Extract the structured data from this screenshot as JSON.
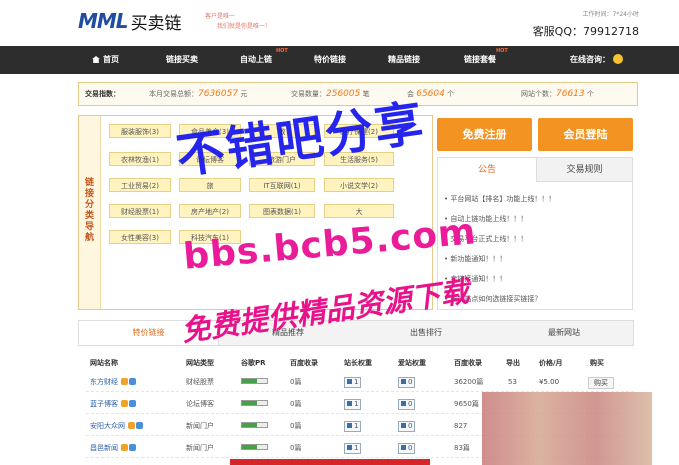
{
  "header": {
    "logo_mark": "MML",
    "logo_cn": "买卖链",
    "slogan_line1": "客户是唯一",
    "slogan_line2": "我们就是你是唯一!",
    "work_time": "工作时间：7*24小时",
    "qq": "客服QQ：79912718"
  },
  "nav": {
    "items": [
      "首页",
      "链接买卖",
      "自动上链",
      "特价链接",
      "精品链接",
      "链接套餐"
    ],
    "hot_tag": "HOT",
    "consult": "在线咨询："
  },
  "stats": {
    "title": "交易指数：",
    "month_label": "本月交易总额：",
    "month_value": "7636057",
    "month_unit": "元",
    "count_label": "交易数量：",
    "count_value": "256005",
    "count_unit": "笔",
    "member_label": "会",
    "member_value": "65604",
    "member_unit": "个",
    "site_label": "网站个数：",
    "site_value": "76613",
    "site_unit": "个"
  },
  "categories": {
    "side_label": "链接分类导航",
    "items": [
      "服装服饰(3)",
      "食品美食(3)",
      "教",
      "医疗保健(2)",
      "农林牧渔(1)",
      "论坛博客",
      "旅游门户",
      "生活服务(5)",
      "工业贸易(2)",
      "旅",
      "IT互联网(1)",
      "小说文学(2)",
      "财经股票(1)",
      "房产地产(2)",
      "图表数据(1)",
      "大",
      "女性美容(3)",
      "科技汽车(1)"
    ]
  },
  "actions": {
    "register": "免费注册",
    "login": "会员登陆"
  },
  "notices": {
    "tab_notice": "公告",
    "tab_rules": "交易规则",
    "items": [
      "平台网站【排名】功能上线！！！",
      "自动上链功能上线！！！",
      "交易平台正式上线！！！",
      "新功能通知！！！",
      "卖链接通知！！！",
      "正规站点如何选链接买链接？"
    ]
  },
  "table": {
    "tabs": [
      "特价链接",
      "精品推荐",
      "出售排行",
      "最新网站"
    ],
    "headers": [
      "网站名称",
      "网站类型",
      "谷歌PR",
      "百度收录",
      "站长权重",
      "爱站权重",
      "百度收录",
      "导出",
      "价格/月",
      "购买"
    ],
    "rows": [
      {
        "name": "东方财经",
        "type": "财经股票",
        "pr": 0.6,
        "index": "0篇",
        "w1": "1",
        "w2": "0",
        "baidu": "36200篇",
        "out": "53",
        "price": "¥5.00",
        "buy": "购买"
      },
      {
        "name": "蓝子博客",
        "type": "论坛博客",
        "pr": 0.6,
        "index": "0篇",
        "w1": "1",
        "w2": "0",
        "baidu": "9650篇",
        "out": "",
        "price": "",
        "buy": ""
      },
      {
        "name": "安阳大众网",
        "type": "新闻门户",
        "pr": 0.6,
        "index": "0篇",
        "w1": "1",
        "w2": "0",
        "baidu": "827",
        "out": "",
        "price": "",
        "buy": ""
      },
      {
        "name": "昌邑新闻",
        "type": "新闻门户",
        "pr": 0.6,
        "index": "0篇",
        "w1": "1",
        "w2": "0",
        "baidu": "83篇",
        "out": "",
        "price": "",
        "buy": ""
      }
    ]
  },
  "watermark": {
    "line1": "不错吧分享",
    "line2": "bbs.bcb5.com",
    "line3": "免费提供精品资源下载"
  },
  "colors": {
    "accent": "#f39321",
    "nav_bg": "#2d2d2d",
    "stat_num": "#f07a15"
  }
}
